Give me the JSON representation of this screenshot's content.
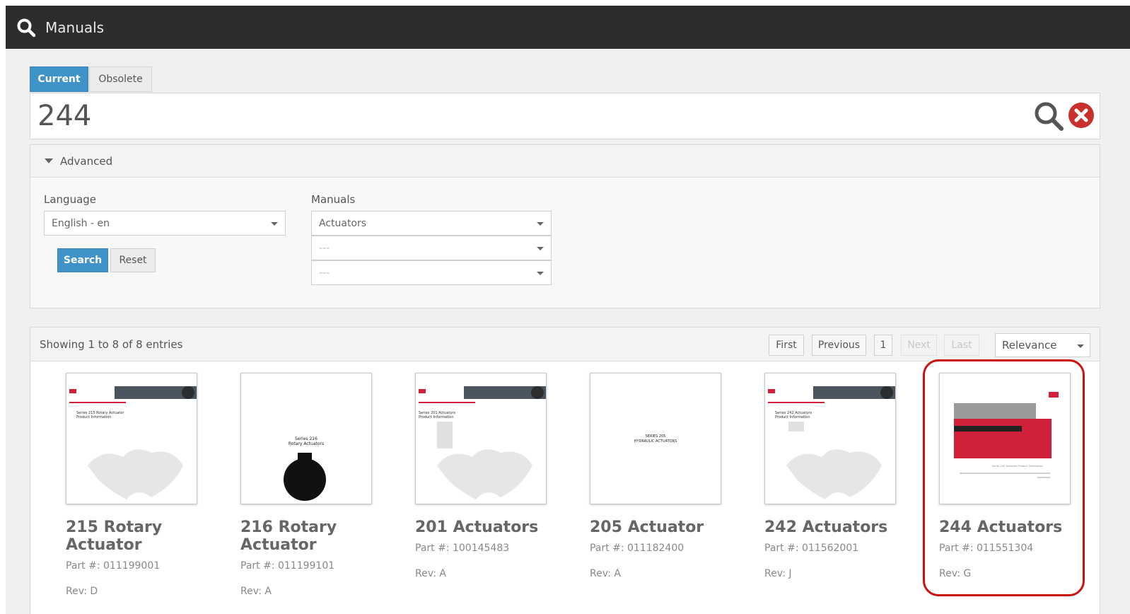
{
  "header": {
    "title": "Manuals",
    "icon": "search-icon"
  },
  "tabs": [
    {
      "label": "Current",
      "active": true
    },
    {
      "label": "Obsolete",
      "active": false
    }
  ],
  "search": {
    "value": "244"
  },
  "advanced": {
    "label": "Advanced",
    "language_label": "Language",
    "language_value": "English - en",
    "manuals_label": "Manuals",
    "manuals_values": [
      "Actuators",
      "---",
      "---"
    ],
    "search_button": "Search",
    "reset_button": "Reset"
  },
  "results": {
    "showing": "Showing 1 to 8 of 8 entries",
    "pagination": {
      "first": "First",
      "previous": "Previous",
      "page": "1",
      "next": "Next",
      "last": "Last"
    },
    "sort_value": "Relevance",
    "items": [
      {
        "title": "215 Rotary Actuator",
        "part": "Part #: 011199001",
        "rev": "Rev: D",
        "thumb_text": [
          "Series 215 Rotary Actuator",
          "Product Information"
        ]
      },
      {
        "title": "216 Rotary Actuator",
        "part": "Part #: 011199101",
        "rev": "Rev: A",
        "thumb_text": [
          "Series 216",
          "Rotary Actuators"
        ]
      },
      {
        "title": "201 Actuators",
        "part": "Part #: 100145483",
        "rev": "Rev: A",
        "thumb_text": [
          "Series 201 Actuators",
          "Product Information"
        ]
      },
      {
        "title": "205 Actuator",
        "part": "Part #: 011182400",
        "rev": "Rev: A",
        "thumb_text": [
          "SERIES 205",
          "HYDRAULIC ACTUATORS"
        ]
      },
      {
        "title": "242 Actuators",
        "part": "Part #: 011562001",
        "rev": "Rev: J",
        "thumb_text": [
          "Series 242 Actuators",
          "Product Information"
        ]
      },
      {
        "title": "244 Actuators",
        "part": "Part #: 011551304",
        "rev": "Rev: G",
        "thumb_text": [
          "Series 244 Actuators Product Information"
        ]
      }
    ]
  },
  "colors": {
    "accent": "#3f93c9",
    "header_bg": "#2b2d2e",
    "highlight": "#cc1111",
    "brand_red": "#d0203a"
  }
}
